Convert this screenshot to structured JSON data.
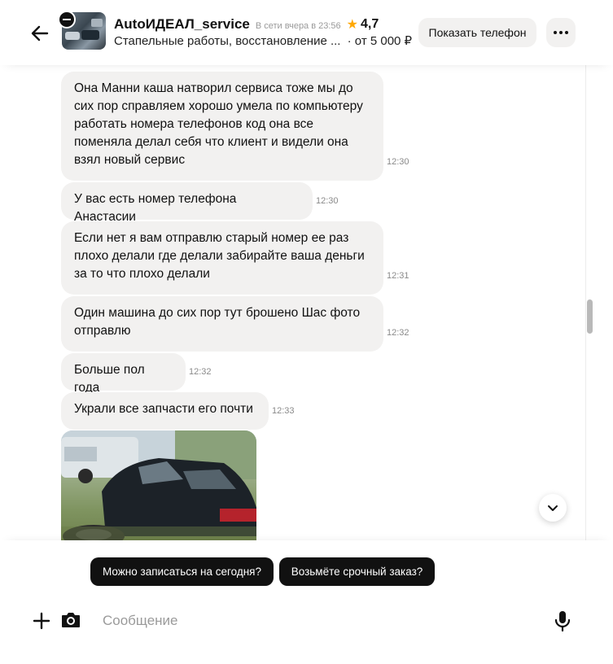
{
  "header": {
    "title": "AutoИДЕАЛ_service",
    "status": "В сети вчера в 23:56",
    "rating": "4,7",
    "subtitle": "Стапельные работы, восстановление ...",
    "price": "· от 5 000 ₽",
    "phone_button": "Показать телефон",
    "icons": {
      "back": "arrow-left-icon",
      "more": "more-dots-icon",
      "star": "star-icon"
    }
  },
  "messages": [
    {
      "text": "Она Манни каша натворил сервиса тоже мы до сих пор справляем  хорошо умела по компьютеру работать номера телефонов код она все поменяла делал себя что клиент и  видели она взял новый сервис",
      "time": "12:30"
    },
    {
      "text": "У вас есть номер телефона Анастасии",
      "time": "12:30"
    },
    {
      "text": "Если нет я вам отправлю старый номер ее раз плохо делали где делали  забирайте ваша деньги за то что плохо делали",
      "time": "12:31"
    },
    {
      "text": "Один машина до сих пор тут брошено Шас фото отправлю",
      "time": "12:32"
    },
    {
      "text": "Больше пол года",
      "time": "12:32"
    },
    {
      "text": "Украли все запчасти его почти",
      "time": "12:33"
    }
  ],
  "quick_replies": [
    "Можно записаться на сегодня?",
    "Возьмёте срочный заказ?"
  ],
  "composer": {
    "placeholder": "Сообщение",
    "icons": {
      "add": "plus-icon",
      "camera": "camera-icon",
      "mic": "microphone-icon"
    }
  },
  "colors": {
    "bubble": "#f2f1f0",
    "chip": "#111111",
    "star": "#ffa800"
  }
}
